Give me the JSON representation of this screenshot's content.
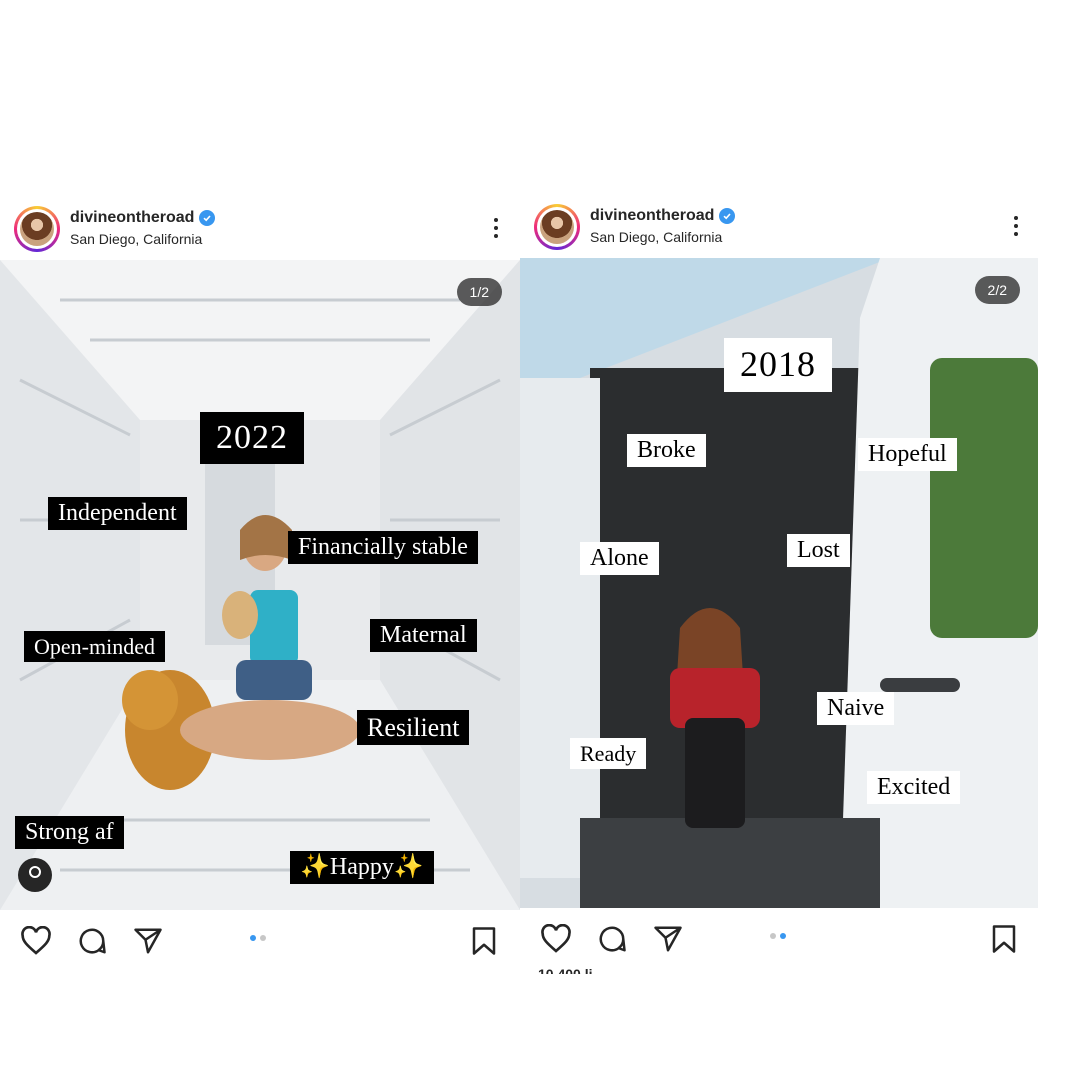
{
  "posts": [
    {
      "username": "divineontheroad",
      "location": "San Diego, California",
      "counter": "1/2",
      "year": "2022",
      "tags": [
        "Independent",
        "Financially stable",
        "Open-minded",
        "Maternal",
        "Resilient",
        "Strong af",
        "✨Happy✨"
      ]
    },
    {
      "username": "divineontheroad",
      "location": "San Diego, California",
      "counter": "2/2",
      "year": "2018",
      "tags": [
        "Broke",
        "Hopeful",
        "Alone",
        "Lost",
        "Naive",
        "Ready",
        "Excited"
      ],
      "likes_partial": "10,400 li..."
    }
  ],
  "icons": [
    "heart-icon",
    "comment-icon",
    "share-icon",
    "bookmark-icon",
    "verified-icon",
    "more-icon",
    "user-tag-icon"
  ],
  "colors": {
    "accent": "#3897f0",
    "text": "#262626",
    "tag_dark": "#000000",
    "tag_light": "#ffffff"
  }
}
